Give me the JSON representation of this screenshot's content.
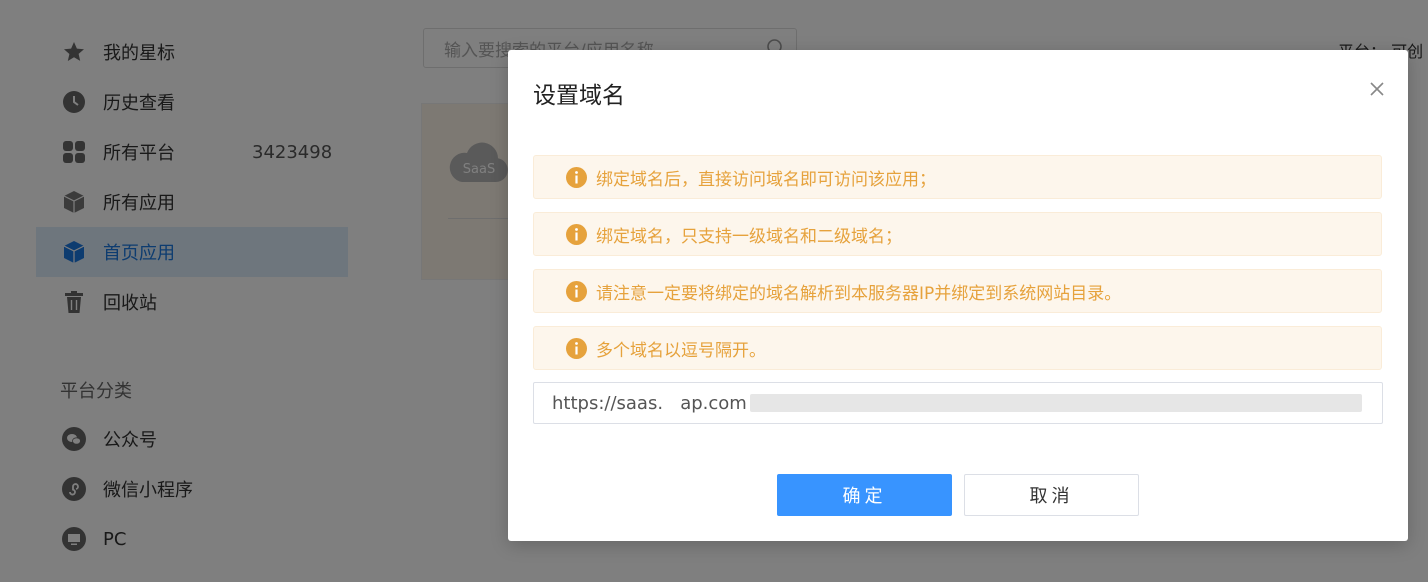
{
  "sidebar": {
    "items": [
      {
        "label": "我的星标",
        "icon": "star-icon"
      },
      {
        "label": "历史查看",
        "icon": "clock-icon"
      },
      {
        "label": "所有平台",
        "icon": "grid-icon",
        "count": "3423498"
      },
      {
        "label": "所有应用",
        "icon": "cube-icon"
      },
      {
        "label": "首页应用",
        "icon": "cube-icon",
        "active": true
      },
      {
        "label": "回收站",
        "icon": "trash-icon"
      }
    ],
    "section_title": "平台分类",
    "categories": [
      {
        "label": "公众号",
        "icon": "wechat-icon"
      },
      {
        "label": "微信小程序",
        "icon": "miniprogram-icon"
      },
      {
        "label": "PC",
        "icon": "monitor-icon"
      }
    ]
  },
  "search": {
    "placeholder": "输入要搜索的平台/应用名称"
  },
  "header": {
    "platform_text": "平台：  可创"
  },
  "card": {
    "logo_text": "SaaS"
  },
  "modal": {
    "title": "设置域名",
    "alerts": [
      "绑定域名后，直接访问域名即可访问该应用；",
      "绑定域名，只支持一级域名和二级域名；",
      "请注意一定要将绑定的域名解析到本服务器IP并绑定到系统网站目录。",
      "多个域名以逗号隔开。"
    ],
    "domain_value": "https://saas.   ap.com",
    "confirm_label": "确定",
    "cancel_label": "取消"
  },
  "colors": {
    "accent": "#3894ff",
    "warning": "#e6a23c",
    "active_bg": "#dcecfb"
  }
}
